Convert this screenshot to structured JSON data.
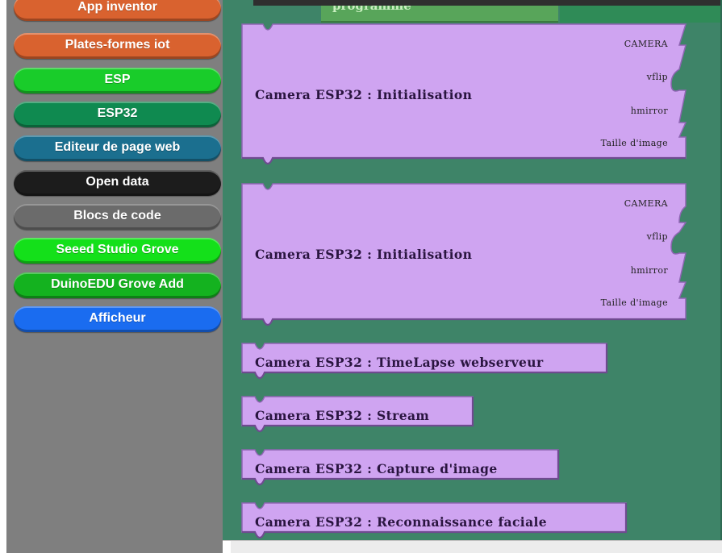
{
  "sidebar": {
    "categories": [
      {
        "label": "App inventor",
        "color": "#d9622f"
      },
      {
        "label": "Plates-formes iot",
        "color": "#d9622f"
      },
      {
        "label": "ESP",
        "color": "#19cc2a"
      },
      {
        "label": "ESP32",
        "color": "#0f8a50"
      },
      {
        "label": "Editeur de page web",
        "color": "#1b6f8f"
      },
      {
        "label": "Open data",
        "color": "#1c1c1c"
      },
      {
        "label": "Blocs de code",
        "color": "#6b6b6b"
      },
      {
        "label": "Seeed Studio Grove",
        "color": "#14e01a"
      },
      {
        "label": "DuinoEDU Grove Add",
        "color": "#14b21f"
      },
      {
        "label": "Afficheur",
        "color": "#1a6cf0"
      }
    ]
  },
  "workspace": {
    "program_block_label": "programme",
    "blocks": [
      {
        "label": "Camera ESP32 : Initialisation",
        "inputs": [
          "CAMERA",
          "vflip",
          "hmirror",
          "Taille d'image"
        ]
      },
      {
        "label": "Camera ESP32 : Initialisation",
        "inputs": [
          "CAMERA",
          "vflip",
          "hmirror",
          "Taille d'image"
        ]
      },
      {
        "label": "Camera ESP32 : TimeLapse webserveur"
      },
      {
        "label": "Camera ESP32 : Stream"
      },
      {
        "label": "Camera ESP32 : Capture d'image"
      },
      {
        "label": "Camera ESP32 : Reconnaissance faciale"
      }
    ],
    "block_color": "#cfa4f1",
    "background_color": "#3e8468"
  }
}
